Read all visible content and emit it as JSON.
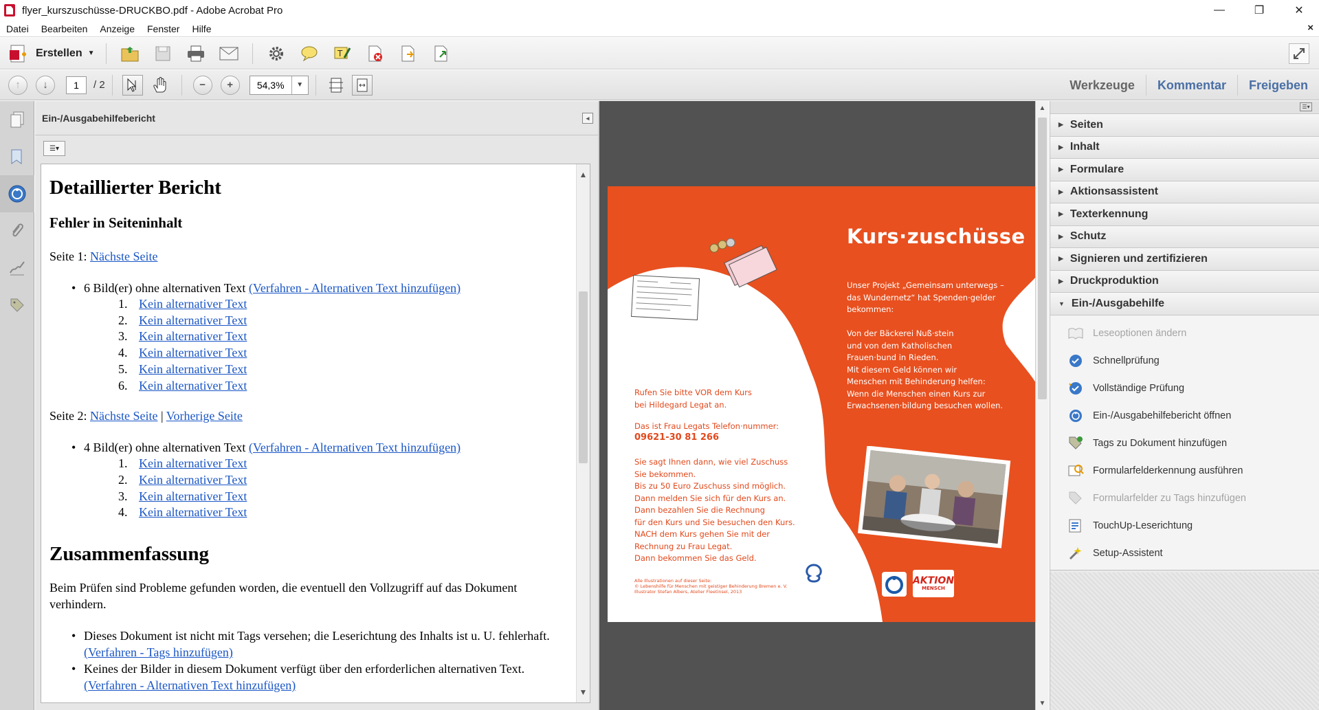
{
  "window": {
    "title": "flyer_kurszuschüsse-DRUCKBO.pdf - Adobe Acrobat Pro",
    "minimize": "—",
    "maximize": "❐",
    "close": "✕"
  },
  "menu": {
    "items": [
      "Datei",
      "Bearbeiten",
      "Anzeige",
      "Fenster",
      "Hilfe"
    ],
    "close": "×"
  },
  "toolbar": {
    "create_label": "Erstellen"
  },
  "nav": {
    "page_current": "1",
    "page_total": "/ 2",
    "zoom": "54,3%",
    "tabs": [
      "Werkzeuge",
      "Kommentar",
      "Freigeben"
    ]
  },
  "report": {
    "panel_title": "Ein-/Ausgabehilfebericht",
    "h1": "Detaillierter Bericht",
    "h2": "Fehler in Seiteninhalt",
    "page1_label": "Seite 1:",
    "next_page": "Nächste Seite",
    "prev_page": "Vorherige Seite",
    "separator": "|",
    "page1_item": "6 Bild(er) ohne alternativen Text",
    "procedure_alt": "(Verfahren - Alternativen Text hinzufügen)",
    "page1_links": [
      "Kein alternativer Text",
      "Kein alternativer Text",
      "Kein alternativer Text",
      "Kein alternativer Text",
      "Kein alternativer Text",
      "Kein alternativer Text"
    ],
    "page2_label": "Seite 2:",
    "page2_item": "4 Bild(er) ohne alternativen Text",
    "page2_links": [
      "Kein alternativer Text",
      "Kein alternativer Text",
      "Kein alternativer Text",
      "Kein alternativer Text"
    ],
    "summary_title": "Zusammenfassung",
    "summary_text": "Beim Prüfen sind Probleme gefunden worden, die eventuell den Vollzugriff auf das Dokument verhindern.",
    "summary_item1": "Dieses Dokument ist nicht mit Tags versehen; die Leserichtung des Inhalts ist u. U. fehlerhaft.",
    "summary_link1": "(Verfahren - Tags hinzufügen)",
    "summary_item2": "Keines der Bilder in diesem Dokument verfügt über den erforderlichen alternativen Text.",
    "summary_link2": "(Verfahren - Alternativen Text hinzufügen)"
  },
  "flyer": {
    "title": "Kurs·zuschüsse",
    "white_text": [
      "Unser Projekt „Gemeinsam unterwegs –",
      "das Wundernetz“ hat Spenden·gelder",
      "bekommen:",
      "",
      "Von der Bäckerei Nuß·stein",
      "und von dem Katholischen",
      "Frauen·bund in Rieden.",
      "Mit diesem Geld können wir",
      "Menschen mit Behinderung helfen:",
      "Wenn die Menschen einen Kurs zur",
      "Erwachsenen·bildung besuchen wollen."
    ],
    "call_text": [
      "Rufen Sie bitte VOR dem Kurs",
      "bei Hildegard Legat an."
    ],
    "phone_label": "Das ist Frau Legats Telefon·nummer:",
    "phone": "09621-30 81 266",
    "info_text": [
      "Sie sagt Ihnen dann, wie viel Zuschuss",
      "Sie bekommen.",
      "Bis zu 50 Euro Zuschuss sind möglich.",
      "Dann melden Sie sich für den Kurs an.",
      "Dann bezahlen Sie die Rechnung",
      "für den Kurs und Sie besuchen den Kurs.",
      "NACH dem Kurs gehen Sie mit der",
      "Rechnung zu Frau Legat.",
      "Dann bekommen Sie das Geld."
    ],
    "credits": [
      "Alle Illustrationen auf dieser Seite:",
      "© Lebenshilfe für Menschen mit geistiger Behinderung Bremen e. V.",
      "Illustrator Stefan Albers, Atelier Fleetinsel, 2013"
    ],
    "logo_aktion": "AKTION",
    "logo_mensch": "MENSCH"
  },
  "tools": {
    "sections": [
      "Seiten",
      "Inhalt",
      "Formulare",
      "Aktionsassistent",
      "Texterkennung",
      "Schutz",
      "Signieren und zertifizieren",
      "Druckproduktion"
    ],
    "open_section": "Ein-/Ausgabehilfe",
    "items": [
      {
        "label": "Leseoptionen ändern",
        "icon": "book-icon",
        "enabled": false
      },
      {
        "label": "Schnellprüfung",
        "icon": "check-circle-icon",
        "enabled": true
      },
      {
        "label": "Vollständige Prüfung",
        "icon": "full-check-icon",
        "enabled": true
      },
      {
        "label": "Ein-/Ausgabehilfebericht öffnen",
        "icon": "accessibility-report-icon",
        "enabled": true
      },
      {
        "label": "Tags zu Dokument hinzufügen",
        "icon": "tag-add-icon",
        "enabled": true
      },
      {
        "label": "Formularfelderkennung ausführen",
        "icon": "form-detect-icon",
        "enabled": true
      },
      {
        "label": "Formularfelder zu Tags hinzufügen",
        "icon": "form-tag-icon",
        "enabled": false
      },
      {
        "label": "TouchUp-Leserichtung",
        "icon": "touchup-icon",
        "enabled": true
      },
      {
        "label": "Setup-Assistent",
        "icon": "wizard-icon",
        "enabled": true
      }
    ]
  },
  "colors": {
    "accent_blue": "#4a6fa5",
    "link": "#1a56c6",
    "flyer_orange": "#e8501f"
  }
}
